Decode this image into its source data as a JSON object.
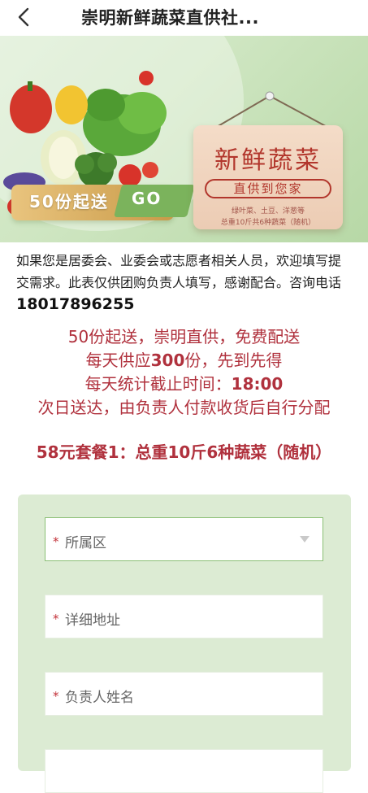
{
  "header": {
    "title": "崇明新鲜蔬菜直供社..."
  },
  "banner": {
    "badge_text": "50份起送",
    "go_text": "GO",
    "sign_title": "新鲜蔬菜",
    "sign_subtitle": "直供到您家",
    "sign_line1": "绿叶菜、土豆、洋葱等",
    "sign_line2": "总重10斤共6种蔬菜（随机）"
  },
  "intro": {
    "text": "如果您是居委会、业委会或志愿者相关人员，欢迎填写提交需求。此表仅供团购负责人填写，感谢配合。咨询电话",
    "phone": "18017896255"
  },
  "promo": {
    "line1": "50份起送，崇明直供，免费配送",
    "line2_prefix": "每天供应",
    "line2_num": "300",
    "line2_suffix": "份，先到先得",
    "line3_prefix": "每天统计截止时间：",
    "line3_time": "18:00",
    "line4": "次日送达，由负责人付款收货后自行分配"
  },
  "package": {
    "text": "58元套餐1：总重10斤6种蔬菜（随机）"
  },
  "form": {
    "fields": [
      {
        "label": "所属区",
        "required_mark": "*"
      },
      {
        "label": "详细地址",
        "required_mark": "*"
      },
      {
        "label": "负责人姓名",
        "required_mark": "*"
      }
    ]
  },
  "colors": {
    "accent_red": "#b0313d",
    "form_bg": "#dcebd3",
    "focus_border": "#8bbf75"
  }
}
